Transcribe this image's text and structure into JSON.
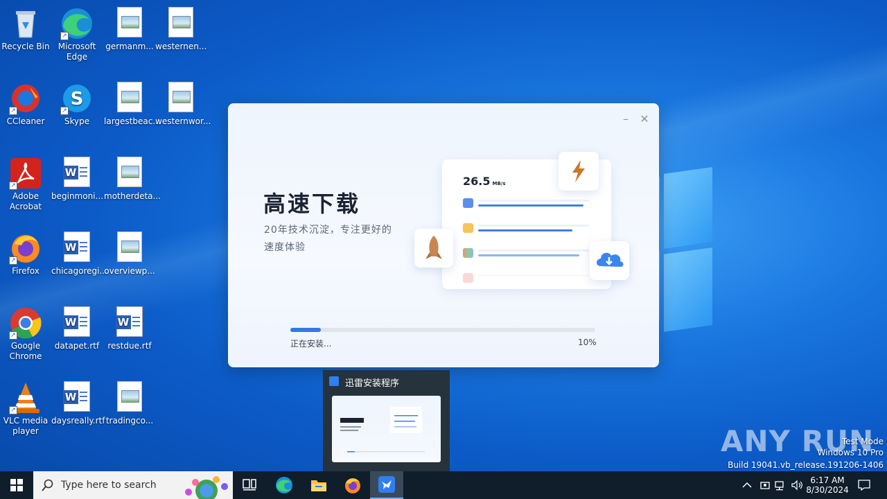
{
  "desktop": {
    "icons": [
      {
        "label": "Recycle Bin"
      },
      {
        "label": "Microsoft Edge"
      },
      {
        "label": "germanm..."
      },
      {
        "label": "westernen..."
      },
      {
        "label": "CCleaner"
      },
      {
        "label": "Skype"
      },
      {
        "label": "largestbeac..."
      },
      {
        "label": "westernwor..."
      },
      {
        "label": "Adobe Acrobat"
      },
      {
        "label": "beginmoni..."
      },
      {
        "label": "motherdeta..."
      },
      {
        "label": "Firefox"
      },
      {
        "label": "chicagoregi..."
      },
      {
        "label": "overviewp..."
      },
      {
        "label": "Google Chrome"
      },
      {
        "label": "datapet.rtf"
      },
      {
        "label": "restdue.rtf"
      },
      {
        "label": "VLC media player"
      },
      {
        "label": "daysreally.rtf"
      },
      {
        "label": "tradingco..."
      }
    ]
  },
  "installer": {
    "headline": "高速下载",
    "subtitle": "20年技术沉淀，专注更好的速度体验",
    "speed_value": "26.5",
    "speed_unit": "MB/s",
    "status": "正在安装...",
    "percent_label": "10%",
    "progress": 0.1,
    "accent_color": "#3478e6"
  },
  "preview": {
    "title": "迅雷安装程序"
  },
  "watermark": {
    "brand": "ANY RUN",
    "mode": "Test Mode",
    "os": "Windows 10 Pro",
    "build": "Build 19041.vb_release.191206-1406"
  },
  "taskbar": {
    "search_placeholder": "Type here to search",
    "time": "6:17 AM",
    "date": "8/30/2024"
  }
}
